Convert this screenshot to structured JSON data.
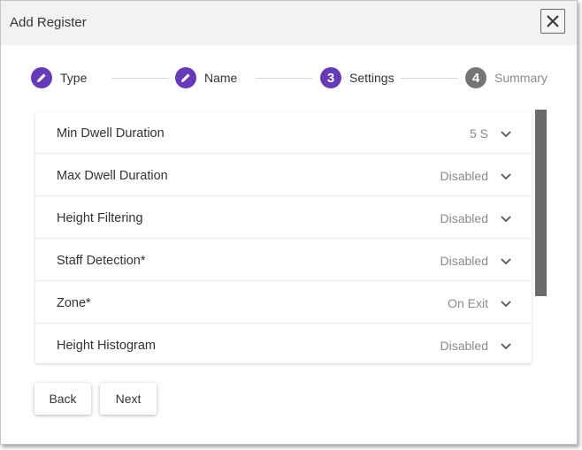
{
  "dialog": {
    "title": "Add Register",
    "close_icon": "close-icon"
  },
  "stepper": {
    "steps": [
      {
        "label": "Type",
        "icon": "pencil-icon",
        "state": "done"
      },
      {
        "label": "Name",
        "icon": "pencil-icon",
        "state": "done"
      },
      {
        "number": "3",
        "label": "Settings",
        "state": "active"
      },
      {
        "number": "4",
        "label": "Summary",
        "state": "inactive"
      }
    ],
    "colors": {
      "accent": "#673ab7",
      "inactive": "#757575",
      "label_active": "#333333",
      "label_inactive": "#8a8a8a"
    }
  },
  "settings": {
    "rows": [
      {
        "label": "Min Dwell Duration",
        "value": "5 S"
      },
      {
        "label": "Max Dwell Duration",
        "value": "Disabled"
      },
      {
        "label": "Height Filtering",
        "value": "Disabled"
      },
      {
        "label": "Staff Detection*",
        "value": "Disabled"
      },
      {
        "label": "Zone*",
        "value": "On Exit"
      },
      {
        "label": "Height Histogram",
        "value": "Disabled"
      }
    ]
  },
  "footer": {
    "back_label": "Back",
    "next_label": "Next"
  }
}
